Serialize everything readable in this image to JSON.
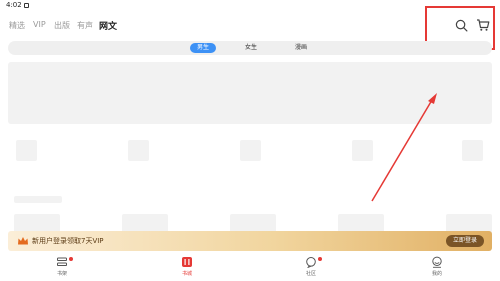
{
  "status_bar": {
    "time": "4:02"
  },
  "top_nav": {
    "tabs": [
      {
        "label": "精选"
      },
      {
        "label": "VIP"
      },
      {
        "label": "出版"
      },
      {
        "label": "有声"
      },
      {
        "label": "网文",
        "active": true
      }
    ],
    "icons": [
      "search-icon",
      "cart-icon"
    ]
  },
  "sub_tabs": [
    {
      "label": "男生",
      "active": true
    },
    {
      "label": "女生"
    },
    {
      "label": "漫画"
    }
  ],
  "promo": {
    "text": "新用户登录领取7天VIP",
    "button": "立即登录"
  },
  "bottom_nav": [
    {
      "label": "书架",
      "icon": "shelf-icon"
    },
    {
      "label": "书城",
      "icon": "bookstore-icon",
      "active": true
    },
    {
      "label": "社区",
      "icon": "community-icon"
    },
    {
      "label": "我的",
      "icon": "profile-icon"
    }
  ],
  "colors": {
    "accent_blue": "#3d91f5",
    "accent_red": "#e53935",
    "annotation_red": "#e53935",
    "promo_gold": "#e1b064"
  }
}
